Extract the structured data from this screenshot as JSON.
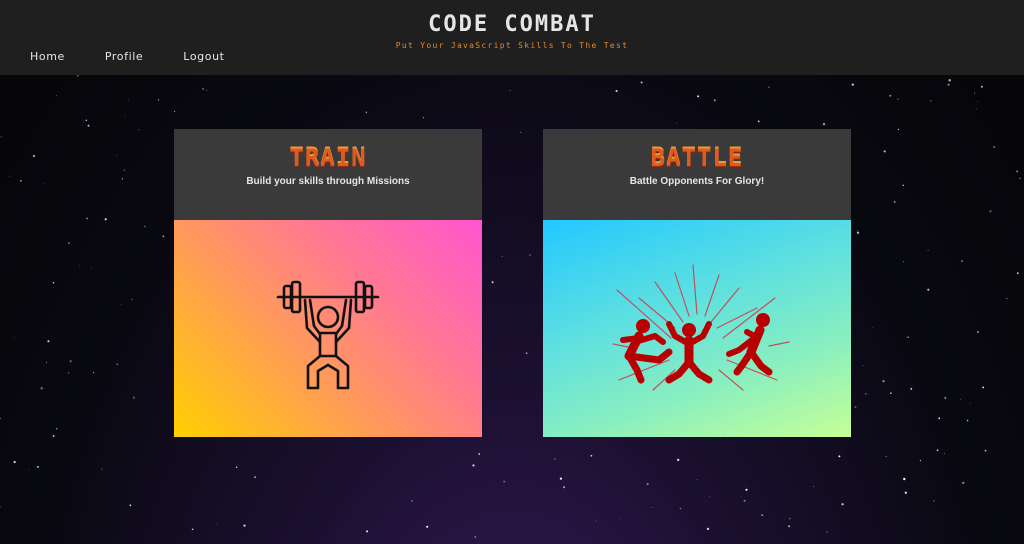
{
  "header": {
    "title": "CODE COMBAT",
    "tagline": "Put Your JavaScript Skills To The Test"
  },
  "nav": {
    "items": [
      {
        "label": "Home"
      },
      {
        "label": "Profile"
      },
      {
        "label": "Logout"
      }
    ]
  },
  "cards": [
    {
      "title": "TRAIN",
      "subtitle": "Build your skills through Missions",
      "icon": "weightlifter-icon"
    },
    {
      "title": "BATTLE",
      "subtitle": "Battle Opponents For Glory!",
      "icon": "fighting-figures-icon"
    }
  ],
  "colors": {
    "header_bg": "#1f1f1f",
    "card_header_bg": "#3a3a3a",
    "accent_orange": "#e05a20",
    "tagline": "#e08a2a",
    "battle_figures": "#c00000"
  }
}
